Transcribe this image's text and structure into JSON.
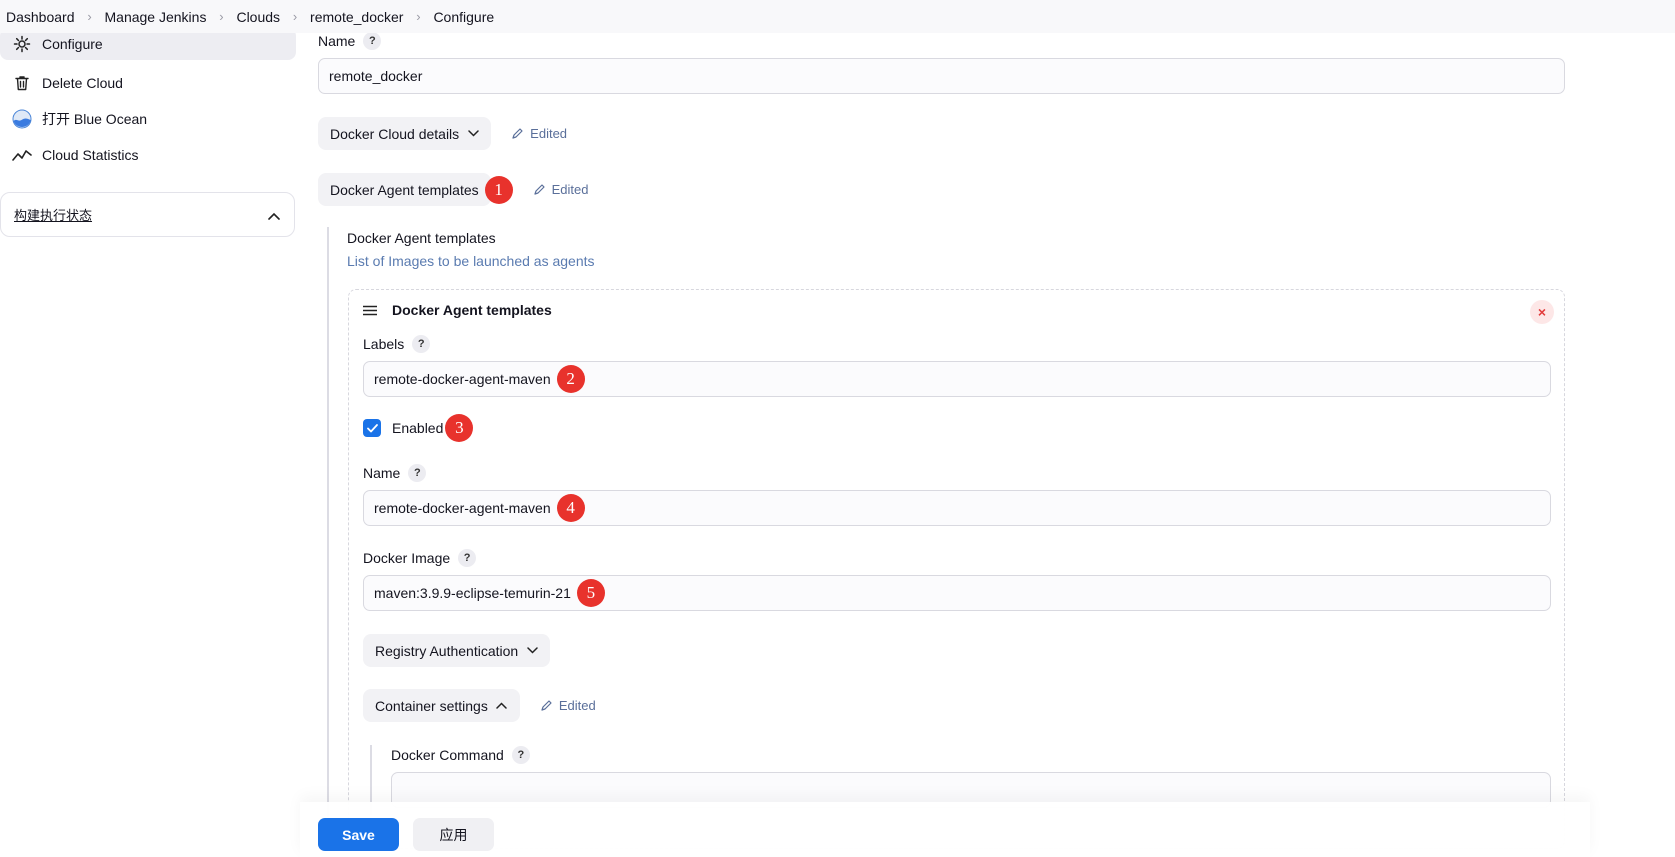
{
  "breadcrumb": [
    "Dashboard",
    "Manage Jenkins",
    "Clouds",
    "remote_docker",
    "Configure"
  ],
  "sidebar": {
    "items": [
      {
        "label": "Configure",
        "icon": "gear-icon"
      },
      {
        "label": "Delete Cloud",
        "icon": "trash-icon"
      },
      {
        "label": "打开 Blue Ocean",
        "icon": "blue-ocean-icon"
      },
      {
        "label": "Cloud Statistics",
        "icon": "chart-line-icon"
      }
    ],
    "panel_title": "构建执行状态"
  },
  "form": {
    "name_label": "Name",
    "name_value": "remote_docker",
    "cloud_details_label": "Docker Cloud details",
    "edited_label": "Edited",
    "agent_templates_label": "Docker Agent templates",
    "section_title": "Docker Agent templates",
    "section_desc": "List of Images to be launched as agents",
    "template": {
      "header": "Docker Agent templates",
      "labels_label": "Labels",
      "labels_value": "remote-docker-agent-maven",
      "enabled_label": "Enabled",
      "name_label": "Name",
      "name_value": "remote-docker-agent-maven",
      "image_label": "Docker Image",
      "image_value": "maven:3.9.9-eclipse-temurin-21",
      "registry_auth_label": "Registry Authentication",
      "container_settings_label": "Container settings",
      "docker_command_label": "Docker Command",
      "docker_command_value": ""
    }
  },
  "badges": [
    "1",
    "2",
    "3",
    "4",
    "5"
  ],
  "help_glyph": "?",
  "buttons": {
    "save": "Save",
    "apply": "应用"
  },
  "colors": {
    "accent": "#1a73e8",
    "badge": "#e8322c",
    "edited": "#5a6f9a"
  }
}
